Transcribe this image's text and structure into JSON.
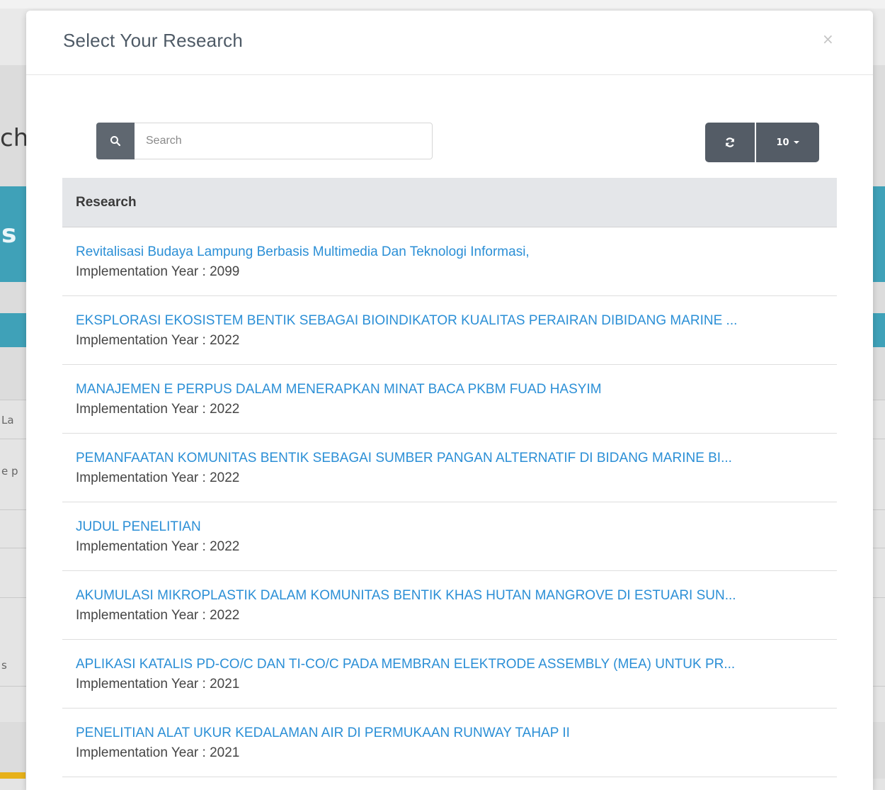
{
  "background": {
    "heading_fragment": "ch",
    "band_fragment": "s",
    "side_fragments": [
      "La",
      "e p",
      "s"
    ]
  },
  "modal": {
    "title": "Select Your Research",
    "close_label": "×",
    "search": {
      "placeholder": "Search"
    },
    "refresh_icon": "refresh-icon",
    "page_size": "10",
    "column_header": "Research",
    "meta_label": "Implementation Year : ",
    "rows": [
      {
        "title": "Revitalisasi Budaya Lampung Berbasis Multimedia Dan Teknologi Informasi,",
        "year": "Implementation Year : 2099"
      },
      {
        "title": "EKSPLORASI EKOSISTEM BENTIK SEBAGAI BIOINDIKATOR KUALITAS PERAIRAN DIBIDANG MARINE ...",
        "year": "Implementation Year : 2022"
      },
      {
        "title": "MANAJEMEN E PERPUS DALAM MENERAPKAN MINAT BACA PKBM FUAD HASYIM",
        "year": "Implementation Year : 2022"
      },
      {
        "title": "PEMANFAATAN KOMUNITAS BENTIK SEBAGAI SUMBER PANGAN ALTERNATIF DI BIDANG MARINE BI...",
        "year": "Implementation Year : 2022"
      },
      {
        "title": "JUDUL PENELITIAN",
        "year": "Implementation Year : 2022"
      },
      {
        "title": "AKUMULASI MIKROPLASTIK DALAM KOMUNITAS BENTIK KHAS HUTAN MANGROVE DI ESTUARI SUN...",
        "year": "Implementation Year : 2022"
      },
      {
        "title": "APLIKASI KATALIS PD-CO/C DAN TI-CO/C PADA MEMBRAN ELEKTRODE ASSEMBLY (MEA) UNTUK PR...",
        "year": "Implementation Year : 2021"
      },
      {
        "title": "PENELITIAN ALAT UKUR KEDALAMAN AIR DI PERMUKAAN RUNWAY TAHAP II",
        "year": "Implementation Year : 2021"
      }
    ]
  },
  "colors": {
    "link": "#2b8fd6",
    "button": "#545c66",
    "accent_band": "#3fa1b8"
  }
}
